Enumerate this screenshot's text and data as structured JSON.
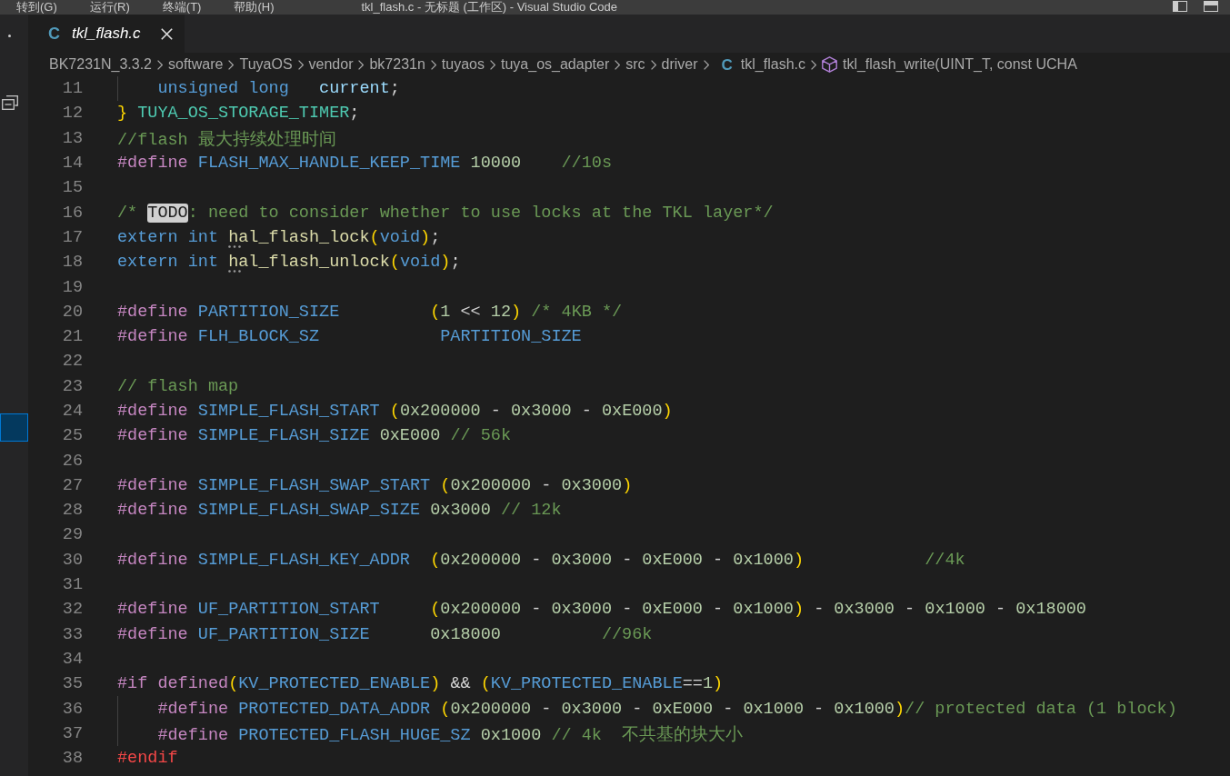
{
  "title_bar": {
    "menus": [
      "转到(G)",
      "运行(R)",
      "终端(T)",
      "帮助(H)"
    ],
    "title": "tkl_flash.c - 无标题 (工作区) - Visual Studio Code"
  },
  "tabs": [
    {
      "icon": "C",
      "label": "tkl_flash.c",
      "selected": true,
      "preview": true
    }
  ],
  "breadcrumb": {
    "folders": [
      "BK7231N_3.3.2",
      "software",
      "TuyaOS",
      "vendor",
      "bk7231n",
      "tuyaos",
      "tuya_os_adapter",
      "src",
      "driver"
    ],
    "file": {
      "icon": "C",
      "label": "tkl_flash.c"
    },
    "symbol": "tkl_flash_write(UINT_T, const UCHA"
  },
  "editor": {
    "lines": [
      {
        "number": "11",
        "indented": true,
        "tokens": [
          {
            "kind": "keyword",
            "text": "unsigned long"
          },
          {
            "kind": "var",
            "text": "   current"
          },
          {
            "kind": "op",
            "text": ";"
          }
        ]
      },
      {
        "number": "12",
        "indented": false,
        "tokens": [
          {
            "kind": "paren",
            "text": "}"
          },
          {
            "kind": "type",
            "text": " TUYA_OS_STORAGE_TIMER"
          },
          {
            "kind": "op",
            "text": ";"
          }
        ]
      },
      {
        "number": "13",
        "indented": false,
        "tokens": [
          {
            "kind": "comment",
            "text": "//flash 最大持续处理时间"
          }
        ]
      },
      {
        "number": "14",
        "indented": false,
        "tokens": [
          {
            "kind": "pre",
            "text": "#define"
          },
          {
            "kind": "macro",
            "text": " FLASH_MAX_HANDLE_KEEP_TIME "
          },
          {
            "kind": "num",
            "text": "10000"
          },
          {
            "kind": "comment",
            "text": "    //10s"
          }
        ]
      },
      {
        "number": "15"
      },
      {
        "number": "16",
        "indented": false,
        "tokens": [
          {
            "kind": "comment",
            "text": "/* "
          },
          {
            "kind": "todo",
            "text": "TODO"
          },
          {
            "kind": "comment",
            "text": ": need to consider whether to use locks at the TKL layer*/"
          }
        ]
      },
      {
        "number": "17",
        "indented": false,
        "tokens": [
          {
            "kind": "keyword",
            "text": "extern int "
          },
          {
            "kind": "func",
            "text": "hal_flash_lock",
            "hint": true
          },
          {
            "kind": "paren",
            "text": "("
          },
          {
            "kind": "keyword",
            "text": "void"
          },
          {
            "kind": "paren",
            "text": ")"
          },
          {
            "kind": "op",
            "text": ";"
          }
        ]
      },
      {
        "number": "18",
        "indented": false,
        "tokens": [
          {
            "kind": "keyword",
            "text": "extern int "
          },
          {
            "kind": "func",
            "text": "hal_flash_unlock",
            "hint": true
          },
          {
            "kind": "paren",
            "text": "("
          },
          {
            "kind": "keyword",
            "text": "void"
          },
          {
            "kind": "paren",
            "text": ")"
          },
          {
            "kind": "op",
            "text": ";"
          }
        ]
      },
      {
        "number": "19"
      },
      {
        "number": "20",
        "indented": false,
        "tokens": [
          {
            "kind": "pre",
            "text": "#define"
          },
          {
            "kind": "macro",
            "text": " PARTITION_SIZE         "
          },
          {
            "kind": "paren",
            "text": "("
          },
          {
            "kind": "num",
            "text": "1"
          },
          {
            "kind": "op",
            "text": " << "
          },
          {
            "kind": "num",
            "text": "12"
          },
          {
            "kind": "paren",
            "text": ")"
          },
          {
            "kind": "comment",
            "text": " /* 4KB */"
          }
        ]
      },
      {
        "number": "21",
        "indented": false,
        "tokens": [
          {
            "kind": "pre",
            "text": "#define"
          },
          {
            "kind": "macro",
            "text": " FLH_BLOCK_SZ            PARTITION_SIZE"
          }
        ]
      },
      {
        "number": "22"
      },
      {
        "number": "23",
        "indented": false,
        "tokens": [
          {
            "kind": "comment",
            "text": "// flash map"
          }
        ]
      },
      {
        "number": "24",
        "indented": false,
        "tokens": [
          {
            "kind": "pre",
            "text": "#define"
          },
          {
            "kind": "macro",
            "text": " SIMPLE_FLASH_START "
          },
          {
            "kind": "paren",
            "text": "("
          },
          {
            "kind": "num",
            "text": "0x200000"
          },
          {
            "kind": "op",
            "text": " - "
          },
          {
            "kind": "num",
            "text": "0x3000"
          },
          {
            "kind": "op",
            "text": " - "
          },
          {
            "kind": "num",
            "text": "0xE000"
          },
          {
            "kind": "paren",
            "text": ")"
          }
        ]
      },
      {
        "number": "25",
        "indented": false,
        "tokens": [
          {
            "kind": "pre",
            "text": "#define"
          },
          {
            "kind": "macro",
            "text": " SIMPLE_FLASH_SIZE "
          },
          {
            "kind": "num",
            "text": "0xE000"
          },
          {
            "kind": "comment",
            "text": " // 56k"
          }
        ]
      },
      {
        "number": "26"
      },
      {
        "number": "27",
        "indented": false,
        "tokens": [
          {
            "kind": "pre",
            "text": "#define"
          },
          {
            "kind": "macro",
            "text": " SIMPLE_FLASH_SWAP_START "
          },
          {
            "kind": "paren",
            "text": "("
          },
          {
            "kind": "num",
            "text": "0x200000"
          },
          {
            "kind": "op",
            "text": " - "
          },
          {
            "kind": "num",
            "text": "0x3000"
          },
          {
            "kind": "paren",
            "text": ")"
          }
        ]
      },
      {
        "number": "28",
        "indented": false,
        "tokens": [
          {
            "kind": "pre",
            "text": "#define"
          },
          {
            "kind": "macro",
            "text": " SIMPLE_FLASH_SWAP_SIZE "
          },
          {
            "kind": "num",
            "text": "0x3000"
          },
          {
            "kind": "comment",
            "text": " // 12k"
          }
        ]
      },
      {
        "number": "29"
      },
      {
        "number": "30",
        "indented": false,
        "tokens": [
          {
            "kind": "pre",
            "text": "#define"
          },
          {
            "kind": "macro",
            "text": " SIMPLE_FLASH_KEY_ADDR  "
          },
          {
            "kind": "paren",
            "text": "("
          },
          {
            "kind": "num",
            "text": "0x200000"
          },
          {
            "kind": "op",
            "text": " - "
          },
          {
            "kind": "num",
            "text": "0x3000"
          },
          {
            "kind": "op",
            "text": " - "
          },
          {
            "kind": "num",
            "text": "0xE000"
          },
          {
            "kind": "op",
            "text": " - "
          },
          {
            "kind": "num",
            "text": "0x1000"
          },
          {
            "kind": "paren",
            "text": ")"
          },
          {
            "kind": "comment",
            "text": "            //4k"
          }
        ]
      },
      {
        "number": "31"
      },
      {
        "number": "32",
        "indented": false,
        "tokens": [
          {
            "kind": "pre",
            "text": "#define"
          },
          {
            "kind": "macro",
            "text": " UF_PARTITION_START     "
          },
          {
            "kind": "paren",
            "text": "("
          },
          {
            "kind": "num",
            "text": "0x200000"
          },
          {
            "kind": "op",
            "text": " - "
          },
          {
            "kind": "num",
            "text": "0x3000"
          },
          {
            "kind": "op",
            "text": " - "
          },
          {
            "kind": "num",
            "text": "0xE000"
          },
          {
            "kind": "op",
            "text": " - "
          },
          {
            "kind": "num",
            "text": "0x1000"
          },
          {
            "kind": "paren",
            "text": ")"
          },
          {
            "kind": "op",
            "text": " - "
          },
          {
            "kind": "num",
            "text": "0x3000"
          },
          {
            "kind": "op",
            "text": " - "
          },
          {
            "kind": "num",
            "text": "0x1000"
          },
          {
            "kind": "op",
            "text": " - "
          },
          {
            "kind": "num",
            "text": "0x18000"
          }
        ]
      },
      {
        "number": "33",
        "indented": false,
        "tokens": [
          {
            "kind": "pre",
            "text": "#define"
          },
          {
            "kind": "macro",
            "text": " UF_PARTITION_SIZE      "
          },
          {
            "kind": "num",
            "text": "0x18000"
          },
          {
            "kind": "comment",
            "text": "          //96k"
          }
        ]
      },
      {
        "number": "34"
      },
      {
        "number": "35",
        "indented": false,
        "tokens": [
          {
            "kind": "pre",
            "text": "#if defined"
          },
          {
            "kind": "paren",
            "text": "("
          },
          {
            "kind": "macro",
            "text": "KV_PROTECTED_ENABLE"
          },
          {
            "kind": "paren",
            "text": ")"
          },
          {
            "kind": "op",
            "text": " && "
          },
          {
            "kind": "paren",
            "text": "("
          },
          {
            "kind": "macro",
            "text": "KV_PROTECTED_ENABLE"
          },
          {
            "kind": "op",
            "text": "=="
          },
          {
            "kind": "num",
            "text": "1"
          },
          {
            "kind": "paren",
            "text": ")"
          }
        ]
      },
      {
        "number": "36",
        "indented": true,
        "tokens": [
          {
            "kind": "pre",
            "text": "#define"
          },
          {
            "kind": "macro",
            "text": " PROTECTED_DATA_ADDR "
          },
          {
            "kind": "paren",
            "text": "("
          },
          {
            "kind": "num",
            "text": "0x200000"
          },
          {
            "kind": "op",
            "text": " - "
          },
          {
            "kind": "num",
            "text": "0x3000"
          },
          {
            "kind": "op",
            "text": " - "
          },
          {
            "kind": "num",
            "text": "0xE000"
          },
          {
            "kind": "op",
            "text": " - "
          },
          {
            "kind": "num",
            "text": "0x1000"
          },
          {
            "kind": "op",
            "text": " - "
          },
          {
            "kind": "num",
            "text": "0x1000"
          },
          {
            "kind": "paren",
            "text": ")"
          },
          {
            "kind": "comment",
            "text": "// protected data (1 block)"
          }
        ]
      },
      {
        "number": "37",
        "indented": true,
        "tokens": [
          {
            "kind": "pre",
            "text": "#define"
          },
          {
            "kind": "macro",
            "text": " PROTECTED_FLASH_HUGE_SZ "
          },
          {
            "kind": "num",
            "text": "0x1000"
          },
          {
            "kind": "comment",
            "text": " // 4k  不共基的块大小"
          }
        ]
      },
      {
        "number": "38",
        "indented": false,
        "tokens": [
          {
            "kind": "invalid",
            "text": "#endif"
          }
        ]
      }
    ]
  }
}
